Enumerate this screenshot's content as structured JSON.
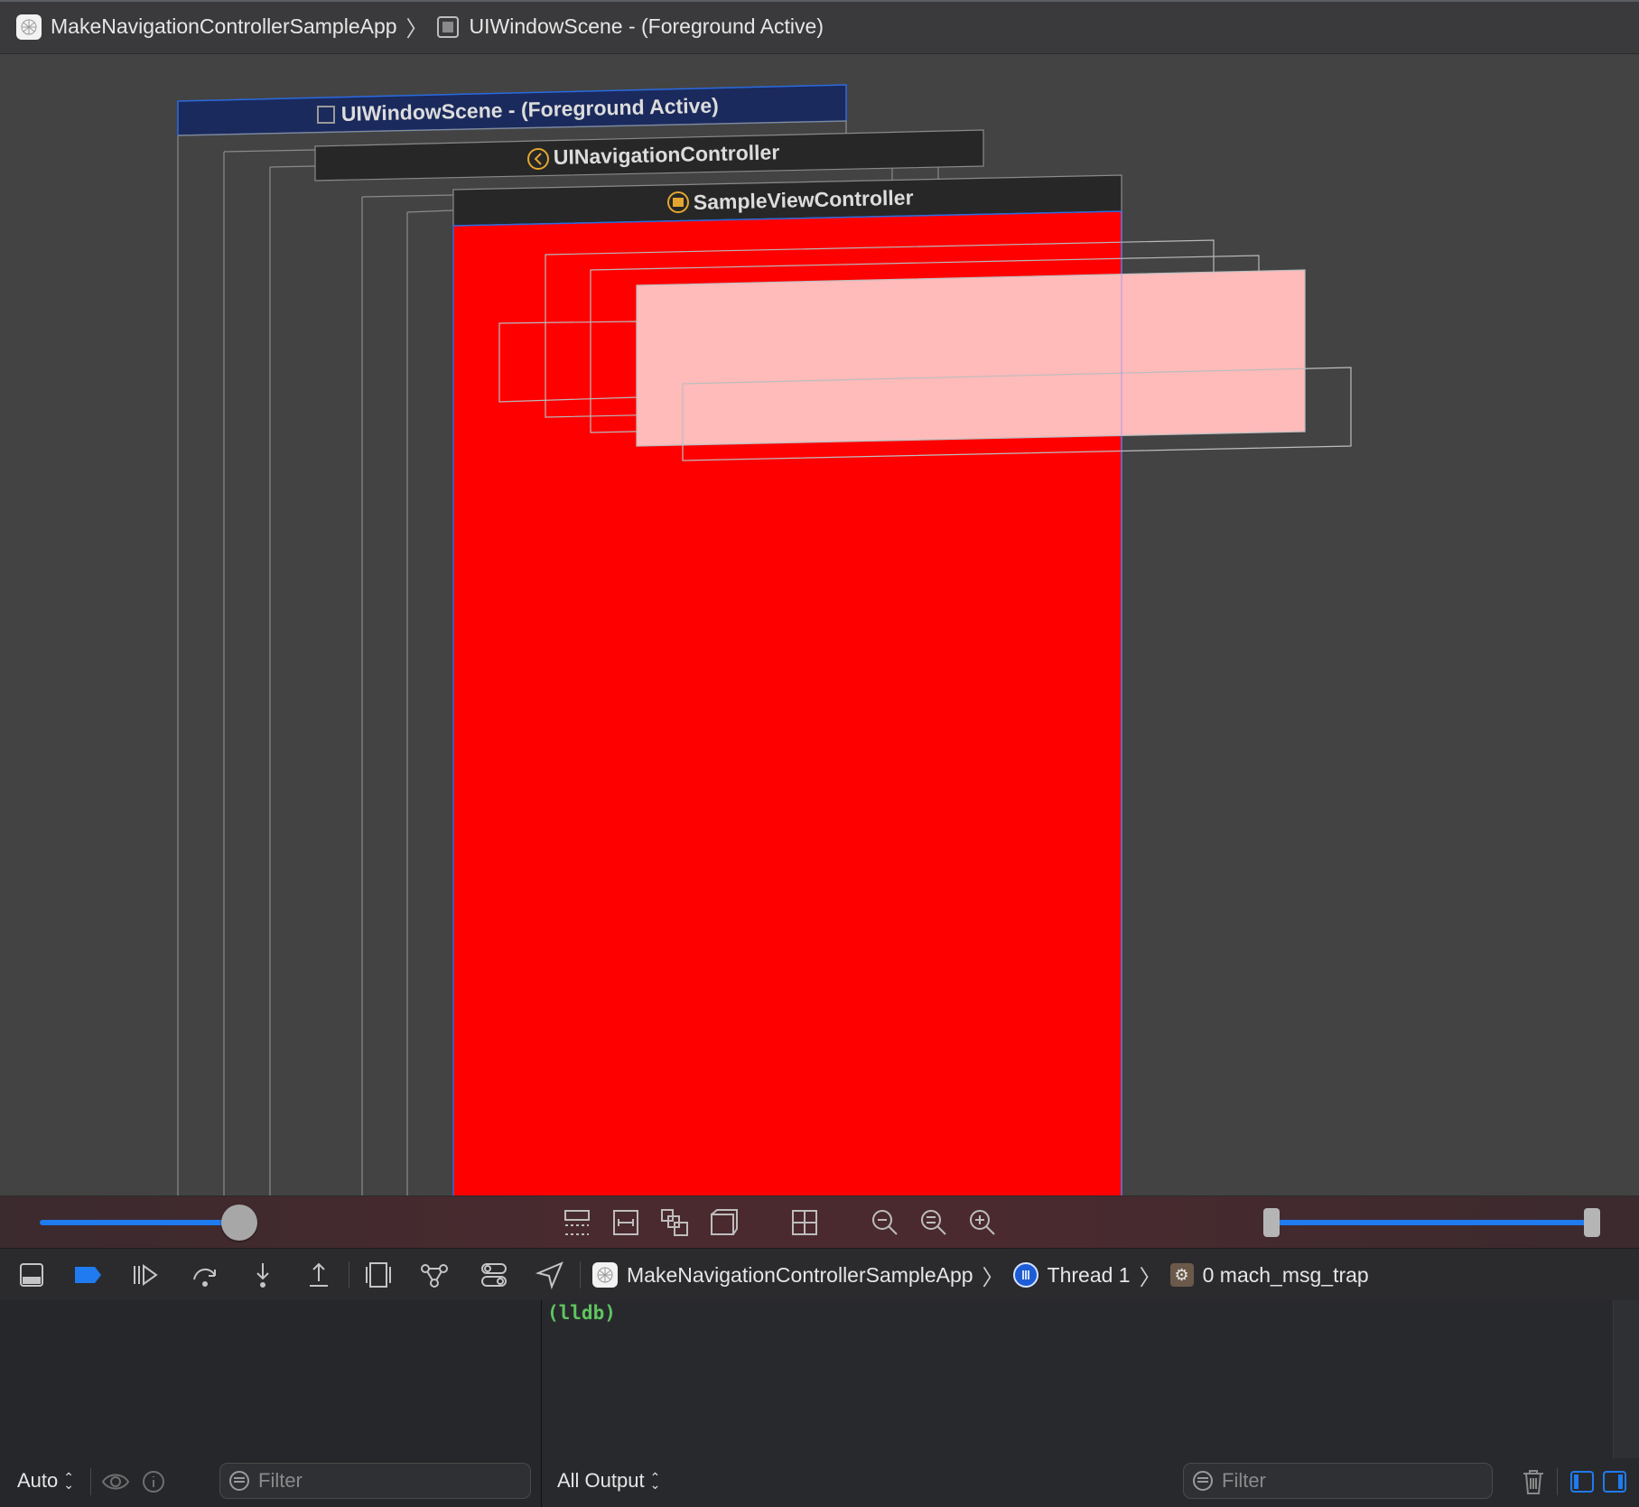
{
  "jump_bar": {
    "app_name": "MakeNavigationControllerSampleApp",
    "scene": "UIWindowScene - (Foreground Active)"
  },
  "canvas": {
    "layers": {
      "window_scene": "UIWindowScene - (Foreground Active)",
      "navigation_controller": "UINavigationController",
      "view_controller": "SampleViewController"
    },
    "colors": {
      "view_background": "#ff0000",
      "subview_fill": "#ffbaba",
      "scene_header": "#1b2a5c",
      "accent": "#1f7bef"
    },
    "spacing_slider_value": 0.18,
    "range_slider": {
      "low": 0.0,
      "high": 1.0
    }
  },
  "debug_bar": {
    "app_name": "MakeNavigationControllerSampleApp",
    "thread": "Thread 1",
    "frame": "0 mach_msg_trap"
  },
  "console": {
    "prompt": "(lldb)",
    "scope_selector": "Auto",
    "output_selector": "All Output",
    "variables_filter_placeholder": "Filter",
    "console_filter_placeholder": "Filter"
  }
}
